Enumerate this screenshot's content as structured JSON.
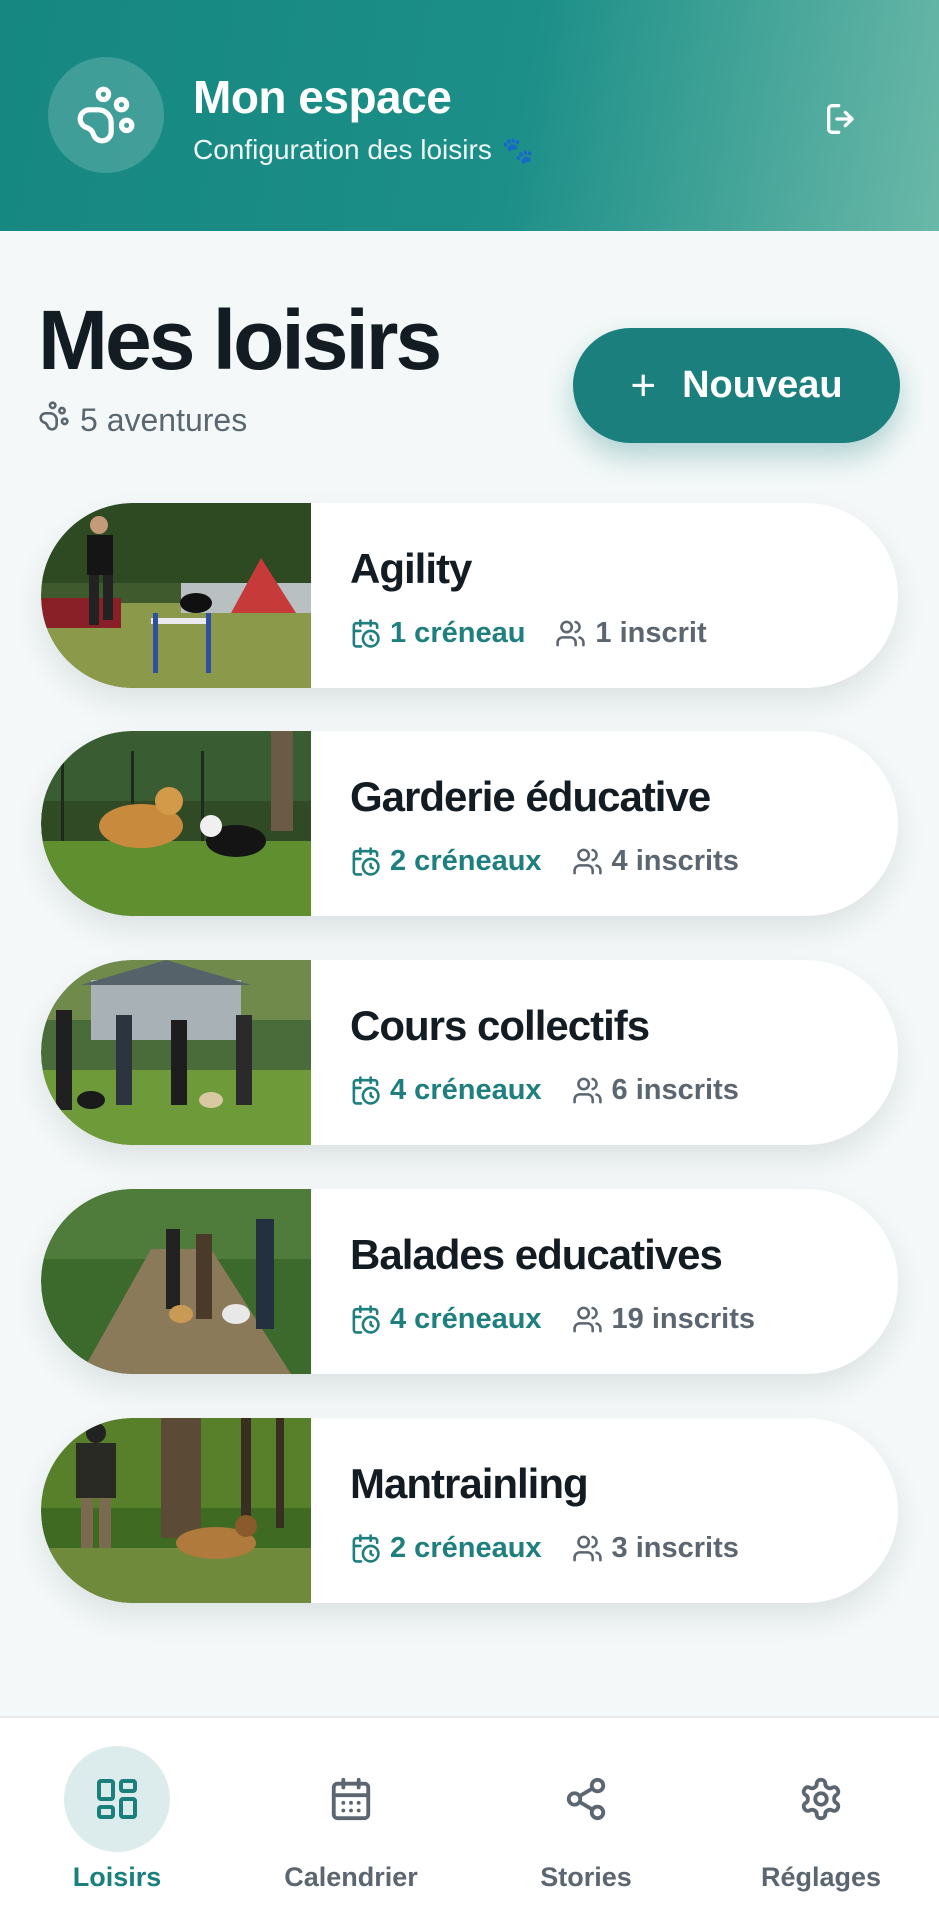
{
  "header": {
    "title": "Mon espace",
    "subtitle": "Configuration des loisirs",
    "logo_icon": "paw-icon",
    "logout_icon": "logout-icon"
  },
  "main": {
    "title": "Mes loisirs",
    "count_label": "5 aventures",
    "new_button_label": "Nouveau"
  },
  "activities": [
    {
      "title": "Agility",
      "slots": "1 créneau",
      "members": "1 inscrit"
    },
    {
      "title": "Garderie éducative",
      "slots": "2 créneaux",
      "members": "4 inscrits"
    },
    {
      "title": "Cours collectifs",
      "slots": "4 créneaux",
      "members": "6 inscrits"
    },
    {
      "title": "Balades educatives",
      "slots": "4 créneaux",
      "members": "19 inscrits"
    },
    {
      "title": "Mantrainling",
      "slots": "2 créneaux",
      "members": "3 inscrits"
    }
  ],
  "nav": [
    {
      "label": "Loisirs",
      "icon": "grid-icon",
      "active": true
    },
    {
      "label": "Calendrier",
      "icon": "calendar-icon",
      "active": false
    },
    {
      "label": "Stories",
      "icon": "share-icon",
      "active": false
    },
    {
      "label": "Réglages",
      "icon": "gear-icon",
      "active": false
    }
  ],
  "colors": {
    "primary": "#1a7f7d",
    "header_gradient_start": "#168781",
    "header_gradient_end": "#6ab8a8",
    "background": "#f4f8f8"
  }
}
